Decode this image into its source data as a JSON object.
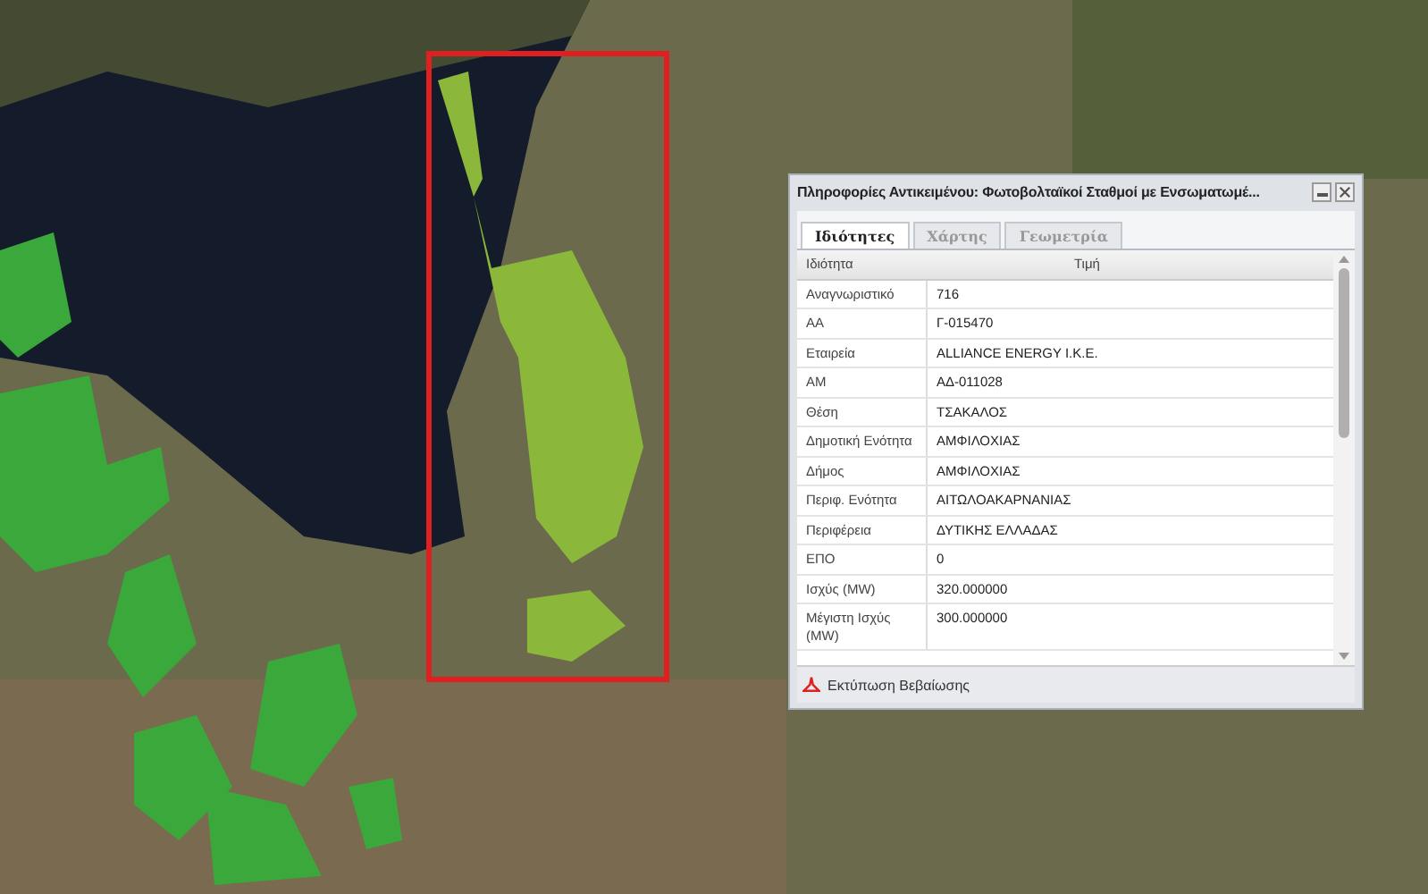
{
  "window": {
    "title": "Πληροφορίες Αντικειμένου: Φωτοβολταϊκοί Σταθμοί με Ενσωματωμέ..."
  },
  "tabs": [
    {
      "label": "Ιδιότητες",
      "selected": true
    },
    {
      "label": "Χάρτης",
      "selected": false
    },
    {
      "label": "Γεωμετρία",
      "selected": false
    }
  ],
  "table": {
    "columns": [
      "Ιδιότητα",
      "Τιμή"
    ],
    "rows": [
      [
        "Αναγνωριστικό",
        "716"
      ],
      [
        "ΑΑ",
        "Γ-015470"
      ],
      [
        "Εταιρεία",
        "ALLIANCE ENERGY I.K.E."
      ],
      [
        "ΑΜ",
        "ΑΔ-011028"
      ],
      [
        "Θέση",
        "ΤΣΑΚΑΛΟΣ"
      ],
      [
        "Δημοτική Ενότητα",
        "ΑΜΦΙΛΟΧΙΑΣ"
      ],
      [
        "Δήμος",
        "ΑΜΦΙΛΟΧΙΑΣ"
      ],
      [
        "Περιφ. Ενότητα",
        "ΑΙΤΩΛΟΑΚΑΡΝΑΝΙΑΣ"
      ],
      [
        "Περιφέρεια",
        "ΔΥΤΙΚΗΣ ΕΛΛΑΔΑΣ"
      ],
      [
        "ΕΠΟ",
        "0"
      ],
      [
        "Ισχύς (MW)",
        "320.000000"
      ],
      [
        "Μέγιστη Ισχύς (MW)",
        "300.000000"
      ]
    ]
  },
  "footer": {
    "button": "Εκτύπωση Βεβαίωσης"
  }
}
